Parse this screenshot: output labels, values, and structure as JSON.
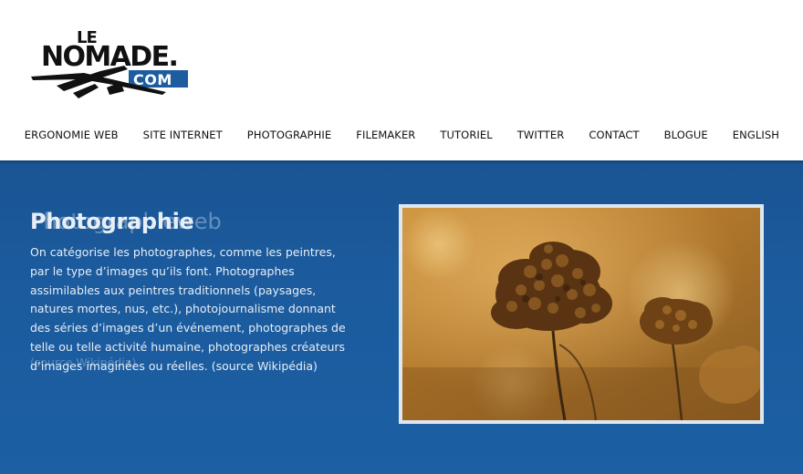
{
  "site": {
    "logo": {
      "line1": "LE",
      "line2": "NOMADE.",
      "line3": "COM"
    }
  },
  "nav": {
    "items": [
      {
        "label": "ERGONOMIE WEB"
      },
      {
        "label": "SITE INTERNET"
      },
      {
        "label": "PHOTOGRAPHIE"
      },
      {
        "label": "FILEMAKER"
      },
      {
        "label": "TUTORIEL"
      },
      {
        "label": "TWITTER"
      },
      {
        "label": "CONTACT"
      },
      {
        "label": "BLOGUE"
      },
      {
        "label": "ENGLISH"
      }
    ]
  },
  "hero": {
    "title": "Photographie",
    "ghost_title": "Photographieweb",
    "text": "On catégorise les photographes, comme les peintres, par le type d’images qu’ils font. Photographes assimilables aux peintres traditionnels (paysages, natures mortes, nus, etc.), photojournalisme donnant des séries d’images d’un événement, photographes de telle ou telle activité humaine, photographes créateurs d’images imaginées ou réelles. (source Wikipédia)",
    "ghost_text": "(source Wikipédia)",
    "colors": {
      "background": "#1b5b9e",
      "text": "#e8eef6",
      "frame": "#dfe6ee"
    }
  }
}
